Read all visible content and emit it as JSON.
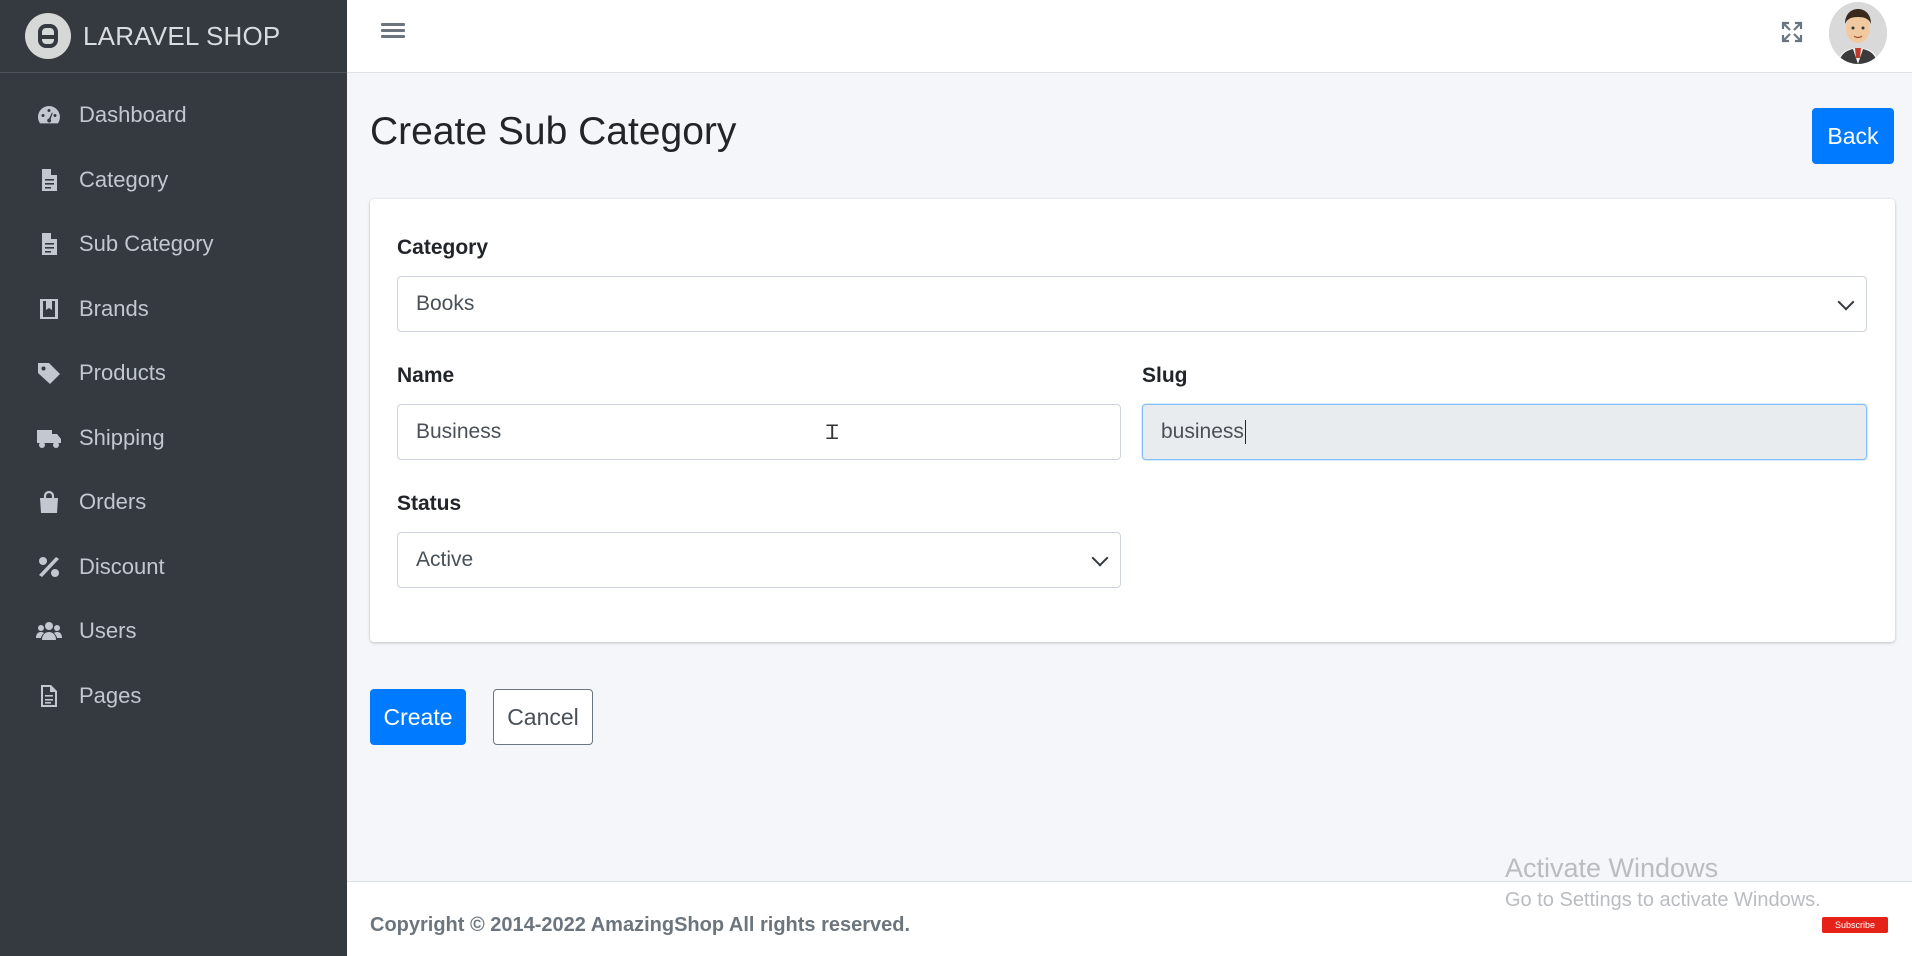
{
  "brand": {
    "name": "LARAVEL SHOP",
    "logo_icon": "laravel-logo-icon"
  },
  "sidebar": {
    "items": [
      {
        "label": "Dashboard",
        "icon": "tachometer-icon"
      },
      {
        "label": "Category",
        "icon": "file-icon"
      },
      {
        "label": "Sub Category",
        "icon": "file-icon"
      },
      {
        "label": "Brands",
        "icon": "bookmark-book-icon"
      },
      {
        "label": "Products",
        "icon": "tag-icon"
      },
      {
        "label": "Shipping",
        "icon": "truck-icon"
      },
      {
        "label": "Orders",
        "icon": "shopping-bag-icon"
      },
      {
        "label": "Discount",
        "icon": "percent-icon"
      },
      {
        "label": "Users",
        "icon": "users-icon"
      },
      {
        "label": "Pages",
        "icon": "file-alt-icon"
      }
    ]
  },
  "header": {
    "menu_icon": "hamburger-icon",
    "fullscreen_icon": "expand-icon",
    "avatar_icon": "user-avatar"
  },
  "page": {
    "title": "Create Sub Category",
    "back_label": "Back"
  },
  "form": {
    "category": {
      "label": "Category",
      "value": "Books"
    },
    "name": {
      "label": "Name",
      "value": "Business"
    },
    "slug": {
      "label": "Slug",
      "value": "business"
    },
    "status": {
      "label": "Status",
      "value": "Active"
    }
  },
  "actions": {
    "create_label": "Create",
    "cancel_label": "Cancel"
  },
  "footer": {
    "copyright": "Copyright © 2014-2022 AmazingShop All rights reserved."
  },
  "overlay": {
    "activate_title": "Activate Windows",
    "activate_sub": "Go to Settings to activate Windows.",
    "subscribe": "Subscribe"
  },
  "colors": {
    "primary": "#007bff",
    "sidebar_bg": "#343a40",
    "content_bg": "#f4f6f9"
  }
}
